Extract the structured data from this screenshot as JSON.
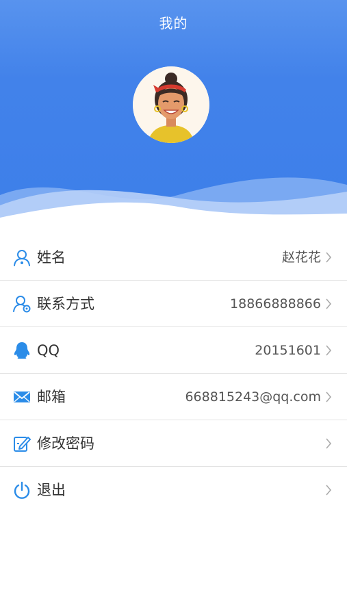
{
  "header": {
    "title": "我的"
  },
  "profile": {
    "avatar_icon": "female-avatar-icon"
  },
  "colors": {
    "header_blue": "#3d7fe9",
    "icon_blue": "#2b8ce8",
    "chevron": "#aaaaaa",
    "divider": "#e3e3e3"
  },
  "items": [
    {
      "label": "姓名",
      "value": "赵花花",
      "icon": "user-icon"
    },
    {
      "label": "联系方式",
      "value": "18866888866",
      "icon": "contact-settings-icon"
    },
    {
      "label": "QQ",
      "value": "20151601",
      "icon": "qq-penguin-icon"
    },
    {
      "label": "邮箱",
      "value": "668815243@qq.com",
      "icon": "mail-icon"
    },
    {
      "label": "修改密码",
      "value": "",
      "icon": "edit-password-icon"
    },
    {
      "label": "退出",
      "value": "",
      "icon": "power-icon"
    }
  ]
}
